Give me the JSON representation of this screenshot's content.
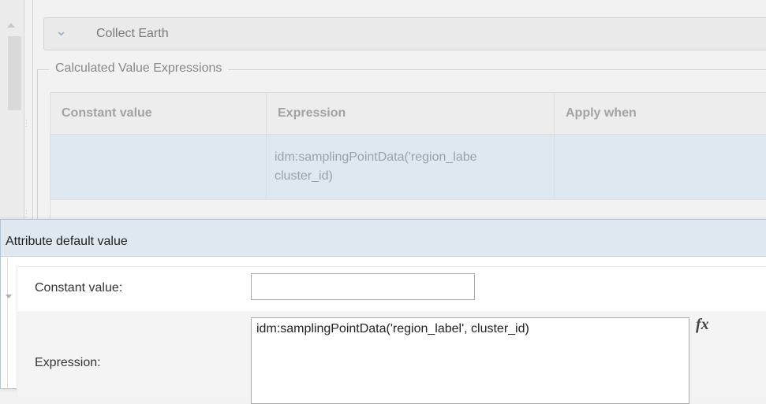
{
  "collect_earth": {
    "title": "Collect Earth",
    "icon": "chevron-down-icon"
  },
  "calculated": {
    "legend": "Calculated Value Expressions",
    "columns": [
      "Constant value",
      "Expression",
      "Apply when"
    ],
    "rows": [
      {
        "constant": "",
        "expression": "idm:samplingPointData('region_labe\ncluster_id)",
        "apply_when": ""
      }
    ]
  },
  "dialog": {
    "title": "Attribute default value",
    "constant_label": "Constant value:",
    "constant_value": "",
    "expression_label": "Expression:",
    "expression_value": "idm:samplingPointData('region_label', cluster_id)",
    "fx_label": "fx"
  },
  "colors": {
    "selected_row": "#dde8f0",
    "dialog_header": "#dfe8ef",
    "chevron": "#7fb0d8"
  }
}
